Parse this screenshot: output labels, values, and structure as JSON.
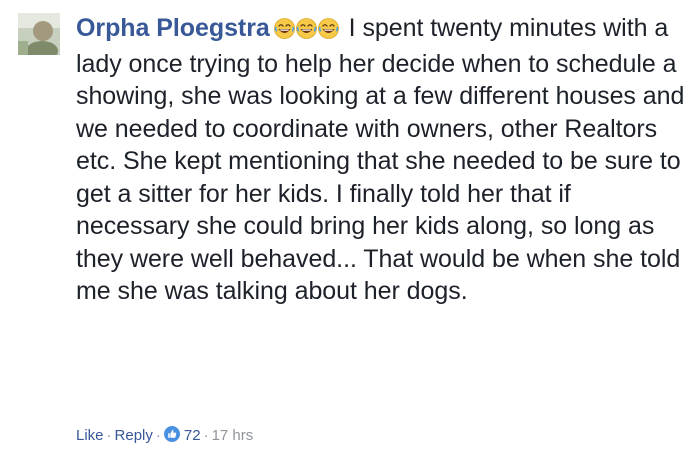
{
  "comment": {
    "author": "Orpha Ploegstra",
    "emojis": [
      "laughing-face-icon",
      "laughing-face-icon",
      "laughing-face-icon"
    ],
    "text": "I spent twenty minutes with a lady once trying to help her decide when to schedule a showing, she was looking at a few different houses and we needed to coordinate with owners, other Realtors etc. She kept mentioning that she needed to be sure to get a sitter for her kids. I finally told her that if necessary she could bring her kids along, so long as they were well behaved... That would be when she told me she was talking about her dogs.",
    "actions": {
      "like_label": "Like",
      "reply_label": "Reply",
      "separator": "·",
      "reaction_icon": "thumbs-up-icon",
      "reaction_count": "72",
      "timestamp": "17 hrs"
    }
  },
  "colors": {
    "author": "#385898",
    "text": "#1d2129",
    "meta": "#90949c",
    "like_badge": "#4a90e2"
  }
}
